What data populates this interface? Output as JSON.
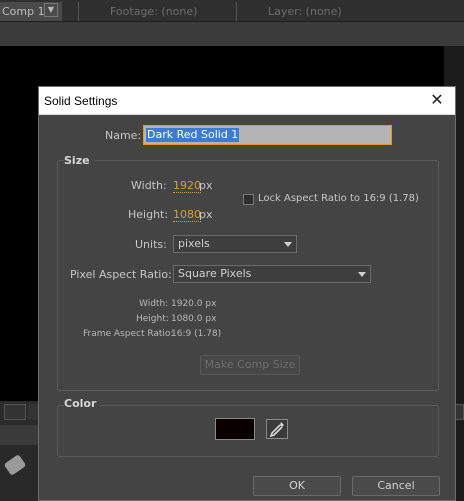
{
  "app": {
    "tabs": {
      "comp": "Comp 1",
      "footage": "Footage: (none)",
      "layer": "Layer: (none)"
    }
  },
  "dialog": {
    "title": "Solid Settings",
    "close_glyph": "✕",
    "name_label": "Name:",
    "name_value": "Dark Red Solid 1",
    "size": {
      "title": "Size",
      "width_label": "Width:",
      "width_value": "1920",
      "width_unit": "px",
      "height_label": "Height:",
      "height_value": "1080",
      "height_unit": "px",
      "lock_label": "Lock Aspect Ratio to 16:9 (1.78)",
      "lock_checked": false,
      "units_label": "Units:",
      "units_value": "pixels",
      "par_label": "Pixel Aspect Ratio:",
      "par_value": "Square Pixels",
      "info_width_label": "Width:",
      "info_width_value": "1920.0 px",
      "info_height_label": "Height:",
      "info_height_value": "1080.0 px",
      "info_far_label": "Frame Aspect Ratio:",
      "info_far_value": "16:9 (1.78)",
      "make_comp_size": "Make Comp Size"
    },
    "color": {
      "title": "Color",
      "swatch": "#0a0000",
      "eyedropper_icon": "eyedropper-icon"
    },
    "ok": "OK",
    "cancel": "Cancel"
  }
}
